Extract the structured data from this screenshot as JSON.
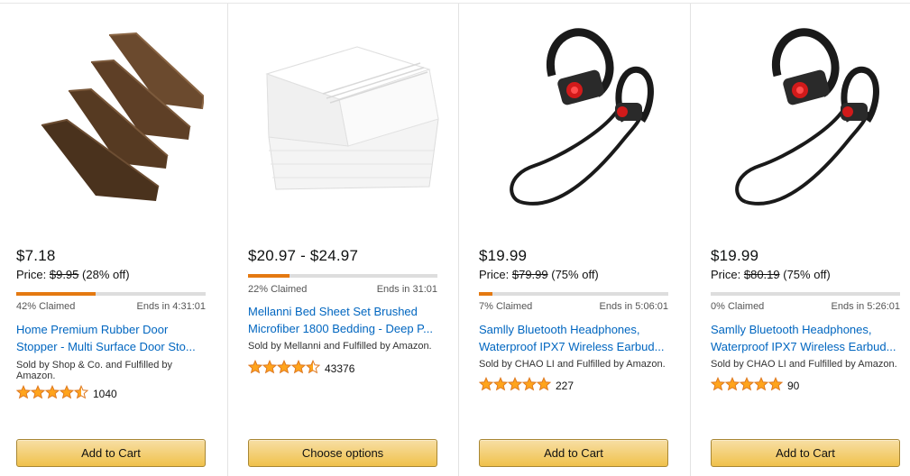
{
  "colors": {
    "link": "#0066c0",
    "claimed_bar": "#e47911",
    "button_top": "#f7dfa5",
    "button_bottom": "#f0c14b",
    "star": "#ffa41c"
  },
  "cards": [
    {
      "image_icon": "door-stopper-image",
      "price": "$7.18",
      "price_label": "Price:",
      "list_price": "$9.95",
      "discount": "(28% off)",
      "claimed_text": "42% Claimed",
      "claimed_fraction": 0.42,
      "ends_in": "Ends in 4:31:01",
      "title_line1": "Home Premium Rubber Door",
      "title_line2": "Stopper - Multi Surface Door Sto...",
      "seller": "Sold by Shop & Co. and Fulfilled by Amazon.",
      "rating": 4.5,
      "review_count": "1040",
      "button_label": "Add to Cart"
    },
    {
      "image_icon": "bed-sheet-image",
      "price": "$20.97 - $24.97",
      "price_label": "",
      "list_price": "",
      "discount": "",
      "claimed_text": "22% Claimed",
      "claimed_fraction": 0.22,
      "ends_in": "Ends in 31:01",
      "title_line1": "Mellanni Bed Sheet Set Brushed",
      "title_line2": "Microfiber 1800 Bedding - Deep P...",
      "seller": "Sold by Mellanni and Fulfilled by Amazon.",
      "rating": 4.5,
      "review_count": "43376",
      "button_label": "Choose options"
    },
    {
      "image_icon": "headphones-image",
      "price": "$19.99",
      "price_label": "Price:",
      "list_price": "$79.99",
      "discount": "(75% off)",
      "claimed_text": "7% Claimed",
      "claimed_fraction": 0.07,
      "ends_in": "Ends in 5:06:01",
      "title_line1": "Samlly Bluetooth Headphones,",
      "title_line2": "Waterproof IPX7 Wireless Earbud...",
      "seller": "Sold by CHAO LI and Fulfilled by Amazon.",
      "rating": 5,
      "review_count": "227",
      "button_label": "Add to Cart"
    },
    {
      "image_icon": "headphones-image",
      "price": "$19.99",
      "price_label": "Price:",
      "list_price": "$80.19",
      "discount": "(75% off)",
      "claimed_text": "0% Claimed",
      "claimed_fraction": 0.0,
      "ends_in": "Ends in 5:26:01",
      "title_line1": "Samlly Bluetooth Headphones,",
      "title_line2": "Waterproof IPX7 Wireless Earbud...",
      "seller": "Sold by CHAO LI and Fulfilled by Amazon.",
      "rating": 5,
      "review_count": "90",
      "button_label": "Add to Cart"
    }
  ]
}
